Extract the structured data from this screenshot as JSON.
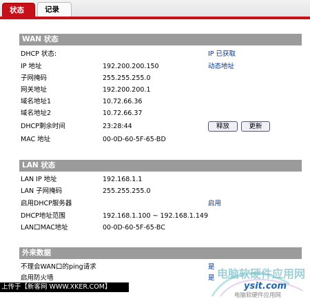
{
  "tabs": {
    "status": "状态",
    "log": "记录"
  },
  "wan": {
    "title": "WAN 状态",
    "rows": [
      {
        "label": "DHCP 状态:",
        "value": "",
        "note": "IP 已获取"
      },
      {
        "label": "IP 地址",
        "value": "192.200.200.150",
        "note": "动态地址"
      },
      {
        "label": "子网掩码",
        "value": "255.255.255.0",
        "note": ""
      },
      {
        "label": "网关地址",
        "value": "192.200.200.1",
        "note": ""
      },
      {
        "label": "域名地址1",
        "value": "10.72.66.36",
        "note": ""
      },
      {
        "label": "域名地址2",
        "value": "10.72.66.37",
        "note": ""
      },
      {
        "label": "DHCP剩余时间",
        "value": "23:28:44",
        "note": ""
      },
      {
        "label": "MAC 地址",
        "value": "00-0D-60-5F-65-BD",
        "note": ""
      }
    ],
    "release_button": "释放",
    "renew_button": "更新"
  },
  "lan": {
    "title": "LAN 状态",
    "rows": [
      {
        "label": "LAN IP 地址",
        "value": "192.168.1.1",
        "note": ""
      },
      {
        "label": "LAN 子网掩码",
        "value": "255.255.255.0",
        "note": ""
      },
      {
        "label": "启用DHCP服务器",
        "value": "",
        "note": "启用"
      },
      {
        "label": "DHCP地址范围",
        "value": "192.168.1.100 ~ 192.168.1.149",
        "note": ""
      },
      {
        "label": "LAN口MAC地址",
        "value": "00-0D-60-5F-65-BC",
        "note": ""
      }
    ]
  },
  "external": {
    "title": "外来数据",
    "rows": [
      {
        "label": "不理会WAN口的ping请求",
        "note": "是"
      },
      {
        "label": "启用防火墙",
        "note": "是"
      }
    ]
  },
  "footer": {
    "text": "上传于【新客网 WWW.XKER.COM】"
  },
  "watermark": {
    "text": "ysit.com",
    "sub": "电脑软硬件应用网",
    "cn": "电脑软硬件应用网"
  },
  "colors": {
    "accent": "#c8101a",
    "section_header": "#9b9b9b",
    "note": "#003399"
  }
}
